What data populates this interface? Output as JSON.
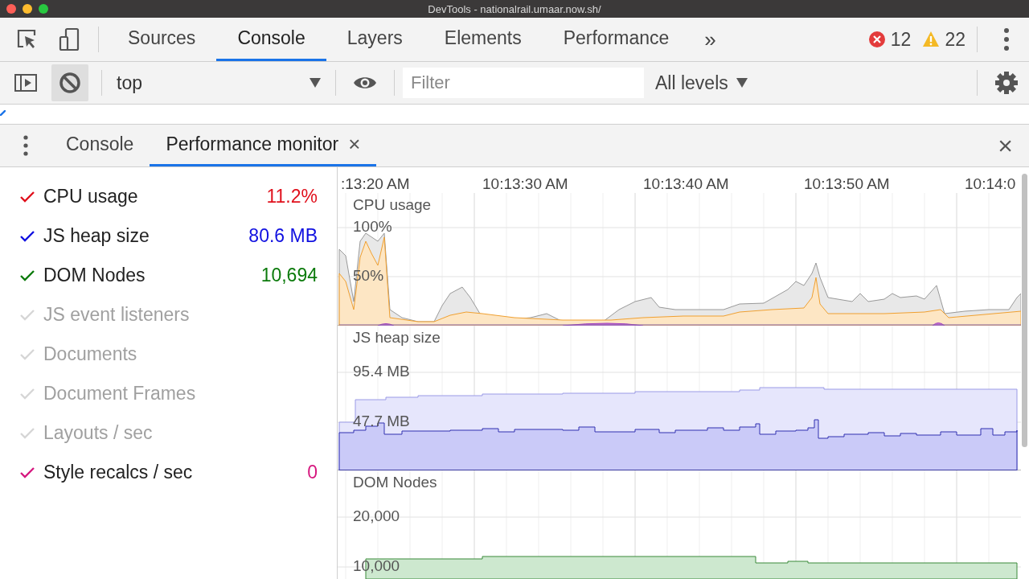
{
  "window": {
    "title": "DevTools - nationalrail.umaar.now.sh/"
  },
  "main_tabs": [
    {
      "label": "Sources",
      "selected": false
    },
    {
      "label": "Console",
      "selected": true
    },
    {
      "label": "Layers",
      "selected": false
    },
    {
      "label": "Elements",
      "selected": false
    },
    {
      "label": "Performance",
      "selected": false
    }
  ],
  "more_tabs": "»",
  "errors": "12",
  "warnings": "22",
  "console_toolbar": {
    "context": "top",
    "filter": {
      "placeholder": "Filter"
    },
    "levels": "All levels",
    "clear_pressed": true
  },
  "drawer_tabs": [
    {
      "label": "Console",
      "selected": false,
      "closable": false
    },
    {
      "label": "Performance monitor",
      "selected": true,
      "closable": true
    }
  ],
  "close_symbol": "×",
  "metrics": [
    {
      "label": "CPU usage",
      "value": "11.2%",
      "checked": true,
      "color": "#e0101c"
    },
    {
      "label": "JS heap size",
      "value": "80.6 MB",
      "checked": true,
      "color": "#1010e0"
    },
    {
      "label": "DOM Nodes",
      "value": "10,694",
      "checked": true,
      "color": "#0b7a0b"
    },
    {
      "label": "JS event listeners",
      "checked": false
    },
    {
      "label": "Documents",
      "checked": false
    },
    {
      "label": "Document Frames",
      "checked": false
    },
    {
      "label": "Layouts / sec",
      "checked": false
    },
    {
      "label": "Style recalcs / sec",
      "value": "0",
      "checked": true,
      "color": "#d6187f"
    }
  ],
  "time_labels": [
    ":13:20 AM",
    "10:13:30 AM",
    "10:13:40 AM",
    "10:13:50 AM",
    "10:14:0"
  ],
  "panels": [
    {
      "kind": "cpu",
      "title": "CPU usage",
      "ticks": [
        "100%",
        "50%"
      ]
    },
    {
      "kind": "heap",
      "title": "JS heap size",
      "ticks": [
        "95.4 MB",
        "47.7 MB"
      ]
    },
    {
      "kind": "dom",
      "title": "DOM Nodes",
      "ticks": [
        "20,000",
        "10,000"
      ]
    }
  ]
}
